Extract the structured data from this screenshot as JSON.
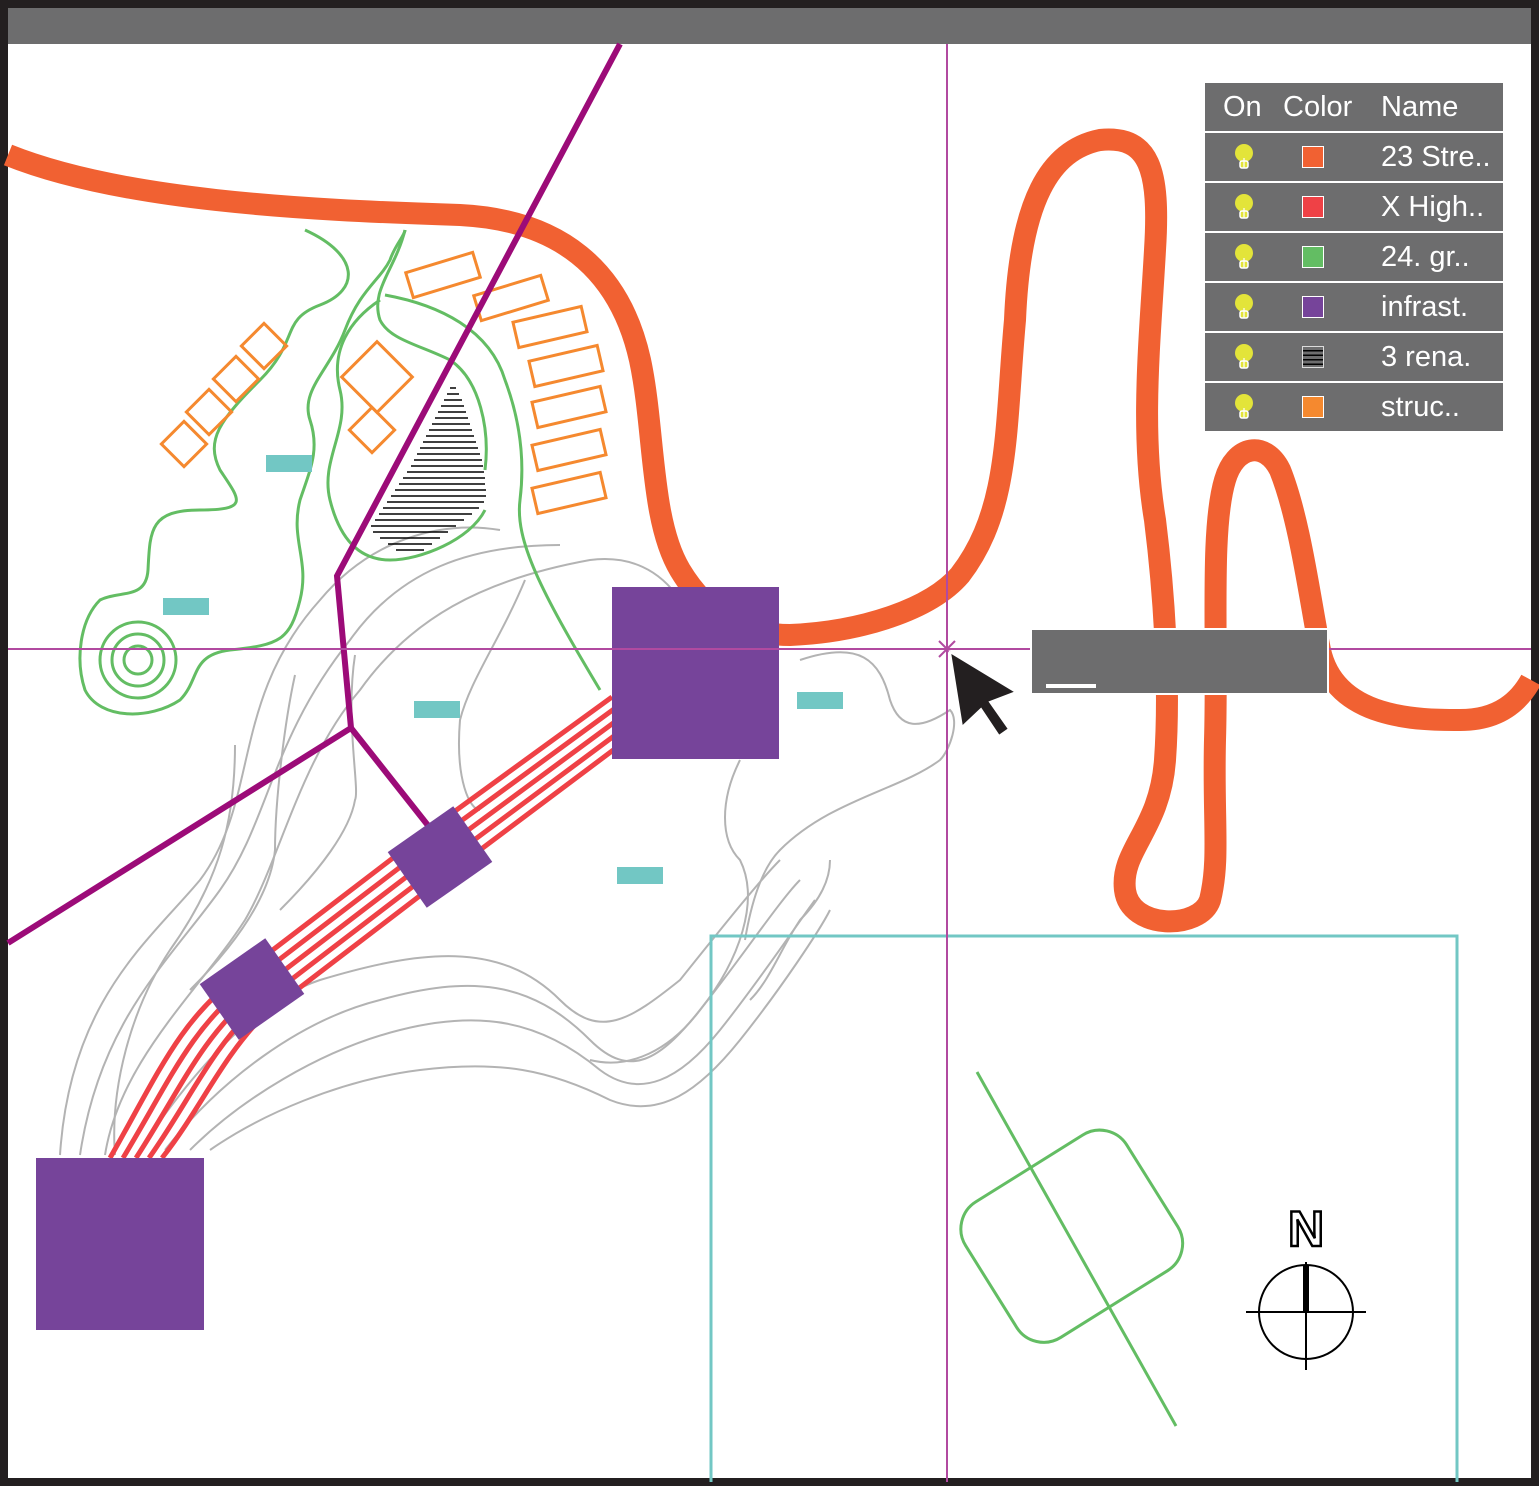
{
  "layer_panel": {
    "headers": {
      "on": "On",
      "color": "Color",
      "name": "Name"
    },
    "layers": [
      {
        "name": "23 Stre..",
        "color": "#f16132",
        "on": true,
        "swatch": "solid"
      },
      {
        "name": "X High..",
        "color": "#ef4146",
        "on": true,
        "swatch": "solid"
      },
      {
        "name": "24. gr..",
        "color": "#63bd63",
        "on": true,
        "swatch": "solid"
      },
      {
        "name": "infrast.",
        "color": "#76449a",
        "on": true,
        "swatch": "solid"
      },
      {
        "name": "3 rena.",
        "color": "#000000",
        "on": true,
        "swatch": "hatched"
      },
      {
        "name": "struc..",
        "color": "#f5892f",
        "on": true,
        "swatch": "solid"
      }
    ]
  },
  "tooltip": {
    "text": ""
  },
  "compass": {
    "label": "N"
  },
  "colors": {
    "street": "#f16132",
    "highway": "#ef4146",
    "green": "#63bd63",
    "infrastructure": "#76449a",
    "structures": "#f5892f",
    "boundary": "#9c0b78",
    "parcel": "#72c7c4",
    "contour": "#b3b3b3",
    "crosshair": "#b14aa0",
    "panel": "#6d6d6e",
    "frame": "#231f20",
    "bulb": "#e3e43a"
  }
}
